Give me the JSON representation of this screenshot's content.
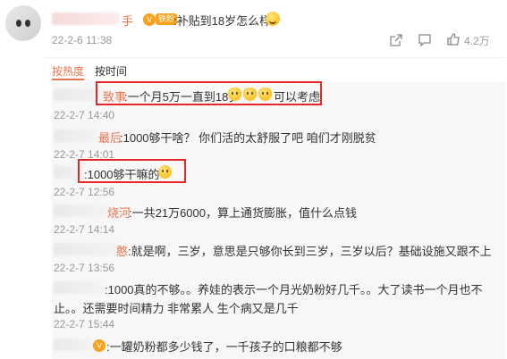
{
  "post": {
    "author_suffix": "手",
    "fan_badge": "铁粉",
    "text": ":补贴到18岁怎么样",
    "timestamp": "22-2-6 11:38",
    "like_count": "4.2万"
  },
  "tabs": [
    {
      "label": "按热度",
      "active": true
    },
    {
      "label": "按时间",
      "active": false
    }
  ],
  "comments": [
    {
      "name_suffix": "致事",
      "text": ":一个月5万一直到18岁",
      "text_after": "可以考虑",
      "timestamp": "22-2-7 14:40"
    },
    {
      "name_suffix": "最后",
      "text": ":1000够干啥？ 你们活的太舒服了吧  咱们才刚脱贫",
      "timestamp": "22-2-7 14:01"
    },
    {
      "name_suffix": "",
      "text": ":1000够干嘛的",
      "timestamp": "22-2-7 12:56"
    },
    {
      "name_suffix": "烧河",
      "text": ":一共21万6000，算上通货膨胀，值什么点钱",
      "timestamp": "22-2-7 14:14"
    },
    {
      "name_suffix": "憨",
      "text": ":就是啊，三岁，意思是只够你长到三岁，三岁以后？基础设施又跟不上",
      "timestamp": "22-2-7 13:56"
    },
    {
      "name_suffix": "",
      "text_line1": ":1000真的不够。。养娃的表示一个月光奶粉好几千。。大了读书一个月也不",
      "text_line2": "止。。还需要时间精力 非常累人 生个病又是几千",
      "timestamp": "22-2-7 15:44"
    },
    {
      "name_suffix": "",
      "text": ":一罐奶粉都多少钱了，一千孩子的口粮都不够"
    }
  ],
  "colors": {
    "accent": "#eb7350",
    "highlight_box": "#e8262a",
    "meta_text": "#999999",
    "comment_panel_bg": "#f7f7f7"
  },
  "icons": [
    "share-icon",
    "comment-icon",
    "like-icon"
  ]
}
